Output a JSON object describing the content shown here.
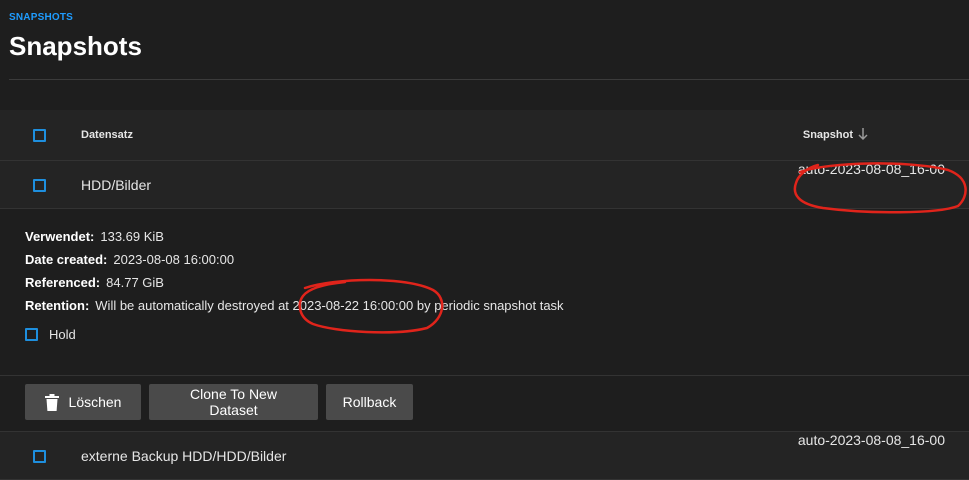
{
  "breadcrumb": "SNAPSHOTS",
  "page_title": "Snapshots",
  "table": {
    "headers": {
      "dataset": "Datensatz",
      "snapshot": "Snapshot"
    },
    "rows": [
      {
        "dataset": "HDD/Bilder",
        "snapshot": "auto-2023-08-08_16-00"
      },
      {
        "dataset": "externe Backup HDD/HDD/Bilder",
        "snapshot": "auto-2023-08-08_16-00"
      }
    ]
  },
  "details": {
    "used_label": "Verwendet:",
    "used_value": "133.69 KiB",
    "created_label": "Date created:",
    "created_value": "2023-08-08 16:00:00",
    "referenced_label": "Referenced:",
    "referenced_value": "84.77 GiB",
    "retention_label": "Retention:",
    "retention_value": "Will be automatically destroyed at 2023-08-22 16:00:00 by periodic snapshot task",
    "hold_label": "Hold"
  },
  "actions": {
    "delete": "Löschen",
    "clone": "Clone To New Dataset",
    "rollback": "Rollback"
  },
  "colors": {
    "accent": "#1e8fde",
    "annotation": "#e0241b"
  },
  "icons": {
    "sort": "arrow-down-icon",
    "delete": "trash-icon"
  }
}
